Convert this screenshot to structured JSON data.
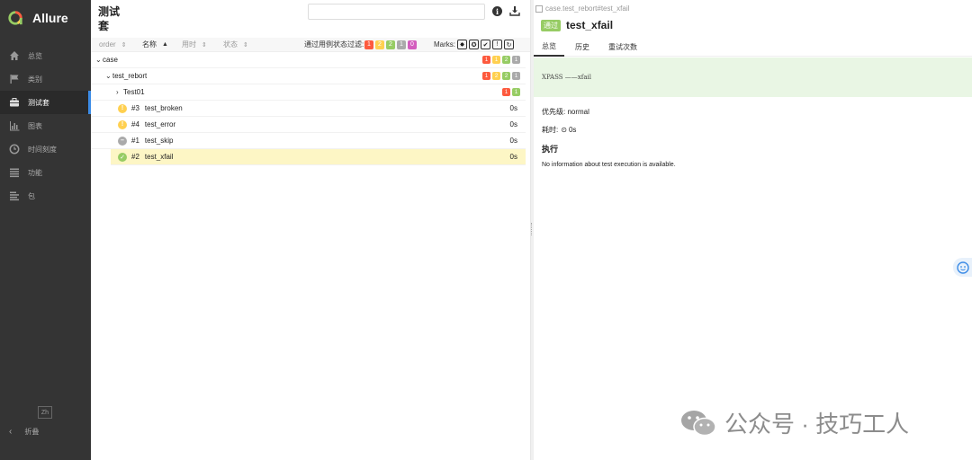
{
  "app": {
    "name": "Allure"
  },
  "sidebar": {
    "items": [
      {
        "label": "总览",
        "icon": "home-icon"
      },
      {
        "label": "类别",
        "icon": "flag-icon"
      },
      {
        "label": "测试套",
        "icon": "briefcase-icon"
      },
      {
        "label": "图表",
        "icon": "bar-chart-icon"
      },
      {
        "label": "时间刻度",
        "icon": "clock-icon"
      },
      {
        "label": "功能",
        "icon": "list-icon"
      },
      {
        "label": "包",
        "icon": "package-icon"
      }
    ],
    "active_index": 2,
    "lang": "Zh",
    "collapse_label": "折叠"
  },
  "tree": {
    "title": "测试套",
    "search_placeholder": "",
    "columns": {
      "order": "order",
      "name": "名称",
      "duration": "用时",
      "status": "状态"
    },
    "filter_label": "通过用例状态过滤:",
    "filter_counts": [
      {
        "value": "1",
        "color": "#fd5a3e"
      },
      {
        "value": "2",
        "color": "#ffd050"
      },
      {
        "value": "2",
        "color": "#97cc64"
      },
      {
        "value": "1",
        "color": "#aaaaaa"
      },
      {
        "value": "0",
        "color": "#d35ebe"
      }
    ],
    "marks_label": "Marks:",
    "rows": [
      {
        "label": "case",
        "counts": [
          "1",
          "1",
          "2",
          "1"
        ]
      },
      {
        "label": "test_rebort",
        "counts": [
          "1",
          "2",
          "2",
          "1"
        ]
      },
      {
        "label": "Test01",
        "counts": [
          "1",
          "1"
        ]
      },
      {
        "num": "#3",
        "label": "test_broken",
        "duration": "0s",
        "status": "broken"
      },
      {
        "num": "#4",
        "label": "test_error",
        "duration": "0s",
        "status": "broken"
      },
      {
        "num": "#1",
        "label": "test_skip",
        "duration": "0s",
        "status": "skipped"
      },
      {
        "num": "#2",
        "label": "test_xfail",
        "duration": "0s",
        "status": "passed"
      }
    ]
  },
  "detail": {
    "breadcrumb": "case.test_rebort#test_xfail",
    "status_badge": "通过",
    "title": "test_xfail",
    "tabs": [
      "总览",
      "历史",
      "重试次数"
    ],
    "message": "XPASS ——xfail",
    "severity_label": "优先级: normal",
    "duration_label": "耗时:",
    "duration_value": "0s",
    "section_title": "执行",
    "no_info": "No information about test execution is available."
  },
  "watermark": {
    "text": "公众号 · 技巧工人"
  },
  "colors": {
    "failed": "#fd5a3e",
    "broken": "#ffd050",
    "passed": "#97cc64",
    "skipped": "#aaaaaa",
    "unknown": "#d35ebe"
  }
}
